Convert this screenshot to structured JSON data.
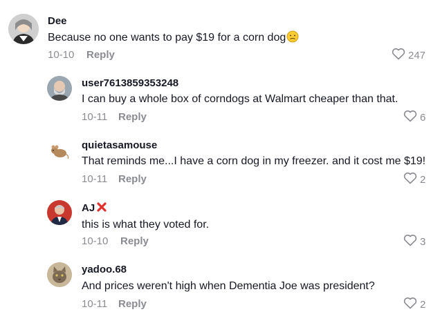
{
  "comments": [
    {
      "username": "Dee",
      "text": "Because no one wants to pay $19 for a corn dog",
      "emoji": "slightly-sad-face-icon",
      "date": "10-10",
      "reply_label": "Reply",
      "likes": "247"
    },
    {
      "username": "user7613859353248",
      "text": "I can buy a whole box of corndogs at Walmart cheaper than that.",
      "date": "10-11",
      "reply_label": "Reply",
      "likes": "6"
    },
    {
      "username": "quietasamouse",
      "text": "That reminds me...I have a corn dog in my freezer. and it cost me $19!",
      "date": "10-11",
      "reply_label": "Reply",
      "likes": "2"
    },
    {
      "username": "AJ",
      "name_suffix_icon": "red-x-icon",
      "text": "this is what they voted for.",
      "date": "10-10",
      "reply_label": "Reply",
      "likes": "3"
    },
    {
      "username": "yadoo.68",
      "text": "And prices weren't high when Dementia Joe was president?",
      "date": "10-11",
      "reply_label": "Reply",
      "likes": "2"
    }
  ],
  "colors": {
    "text": "#161823",
    "muted": "#8a8b91",
    "x_red": "#e0312f",
    "emoji_yellow": "#ffcc33"
  }
}
